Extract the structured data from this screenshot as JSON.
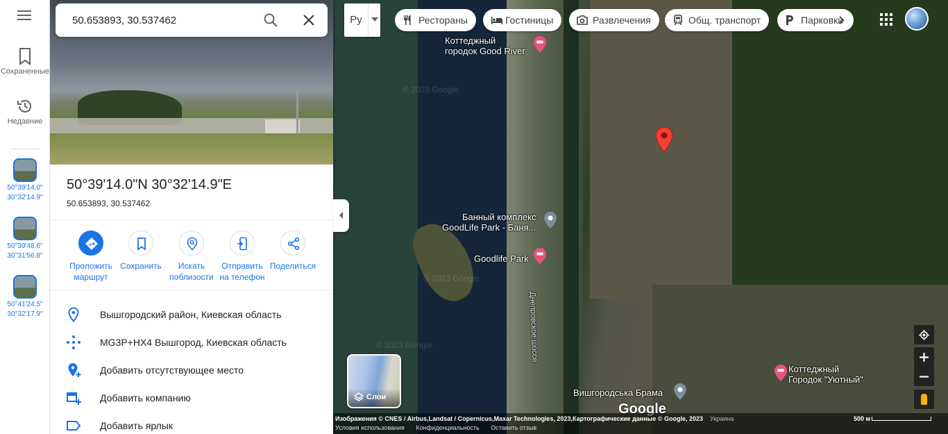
{
  "search": {
    "value": "50.653893, 30.537462"
  },
  "rail": {
    "saved_label": "Сохраненные",
    "recent_label": "Недавние",
    "recent_items": [
      {
        "line1": "50°39'14.0\"",
        "line2": "30°32'14.9\""
      },
      {
        "line1": "50°39'48.6\"",
        "line2": "30°31'56.8\""
      },
      {
        "line1": "50°41'24.5\"",
        "line2": "30°32'17.9\""
      }
    ]
  },
  "place": {
    "title": "50°39'14.0\"N 30°32'14.9\"E",
    "decimal": "50.653893, 30.537462"
  },
  "actions": [
    {
      "line1": "Проложить",
      "line2": "маршрут"
    },
    {
      "line1": "Сохранить",
      "line2": ""
    },
    {
      "line1": "Искать",
      "line2": "поблизости"
    },
    {
      "line1": "Отправить",
      "line2": "на телефон"
    },
    {
      "line1": "Поделиться",
      "line2": ""
    }
  ],
  "info_rows": [
    "Вышгородский район, Киевская область",
    "MG3P+HX4 Вышгород, Киевская область",
    "Добавить отсутствующее место",
    "Добавить компанию",
    "Добавить ярлык"
  ],
  "map": {
    "lang_label": "Ру",
    "chips": [
      "Рестораны",
      "Гостиницы",
      "Развлечения",
      "Общ. транспорт",
      "Парковки"
    ],
    "pois": {
      "good_river_1": "Коттеджный",
      "good_river_2": "городок Good River",
      "bath_1": "Банный комплекс",
      "bath_2": "GoodLife Park -  Баня...",
      "goodlife": "Goodlife Park",
      "uyutny_1": "Коттеджный",
      "uyutny_2": "Городок \"Уютный\"",
      "brama": "Вишгородська Брама"
    },
    "road_label": "Днепровское шоссе",
    "watermark": "© 2023 Google",
    "layers_label": "Слои",
    "google_logo": "Google",
    "attribution": "Изображения © CNES / Airbus,Landsat / Copernicus,Maxar Technologies, 2023,Картографические данные © Google, 2023",
    "country": "Украина",
    "links": [
      "Условия использования",
      "Конфиденциальность",
      "Оставить отзыв"
    ],
    "scale": "500 м"
  }
}
